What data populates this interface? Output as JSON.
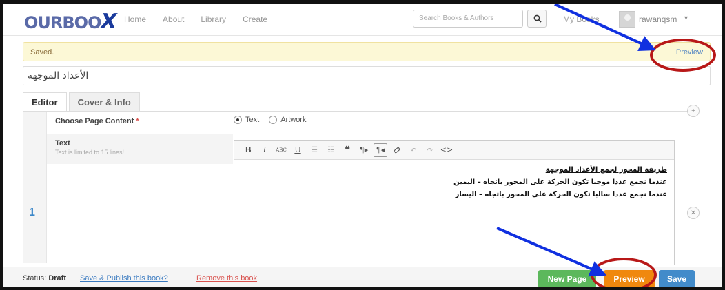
{
  "header": {
    "logo": "OURBOO",
    "logo_x": "X",
    "nav": [
      "Home",
      "About",
      "Library",
      "Create"
    ],
    "search_placeholder": "Search Books & Authors",
    "my_books": "My Books",
    "username": "rawanqsm",
    "caret": "▾"
  },
  "notice": {
    "text": "Saved.",
    "preview_link": "Preview"
  },
  "book_title": "الأعداد الموجهة",
  "tabs": [
    {
      "label": "Editor",
      "active": true
    },
    {
      "label": "Cover & Info",
      "active": false
    }
  ],
  "page": {
    "number": "1",
    "content_label": "Choose Page Content",
    "required_mark": "*",
    "options": [
      {
        "label": "Text",
        "selected": true
      },
      {
        "label": "Artwork",
        "selected": false
      }
    ],
    "text_label": "Text",
    "text_limit": "Text is limited to 15 lines!",
    "lines": [
      "طريقة المحور لجمع الأعداد الموجهة",
      "عندما نجمع عددا موجبا تكون الحركة على المحور باتجاه – اليمين",
      "عندما نجمع عددا سالبا تكون الحركة على المحور باتجاه – اليسار"
    ]
  },
  "toolbar_icons": [
    "bold-icon",
    "italic-icon",
    "strikethrough-icon",
    "underline-icon",
    "bulleted-list-icon",
    "numbered-list-icon",
    "blockquote-icon",
    "ltr-paragraph-icon",
    "rtl-paragraph-icon",
    "eraser-icon",
    "undo-icon",
    "redo-icon",
    "code-icon"
  ],
  "footer": {
    "status_label": "Status:",
    "status_value": "Draft",
    "publish_link": "Save & Publish this book?",
    "remove_link": "Remove this book",
    "new_page": "New Page",
    "preview": "Preview",
    "save": "Save"
  },
  "colors": {
    "accent_blue": "#428bca",
    "green": "#5cb85c",
    "orange": "#f0880e",
    "annotation_red": "#b81818",
    "annotation_arrow": "#1030e0"
  }
}
